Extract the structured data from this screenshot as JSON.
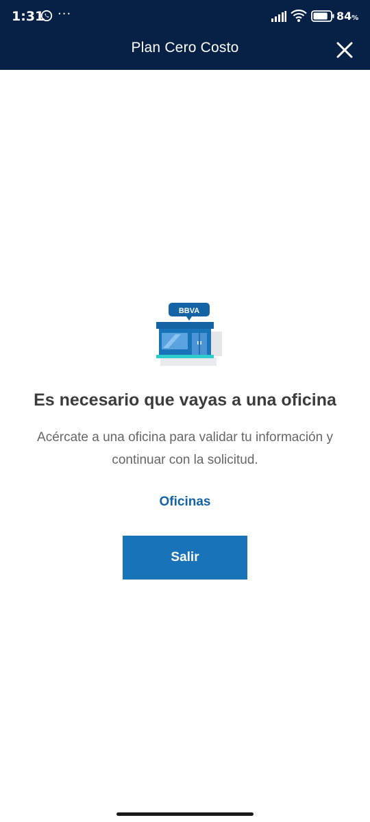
{
  "status_bar": {
    "time": "1:31",
    "more": "···",
    "battery_percent": "84",
    "battery_unit": "%",
    "battery_level": 0.84,
    "icons": [
      "whatsapp-icon",
      "signal-icon",
      "wifi-icon",
      "battery-icon"
    ]
  },
  "header": {
    "title": "Plan Cero Costo",
    "close_icon": "close-icon"
  },
  "illustration": {
    "brand_badge": "BBVA",
    "icon": "bank-office-icon"
  },
  "content": {
    "headline": "Es necesario que vayas a una oficina",
    "description": "Acércate a una oficina para validar tu información y continuar con la solicitud.",
    "offices_link": "Oficinas",
    "exit_button": "Salir"
  },
  "colors": {
    "header_bg": "#072146",
    "primary_button": "#1973b8",
    "link": "#1464a5",
    "headline_text": "#3c3c3c",
    "body_text": "#666666"
  }
}
